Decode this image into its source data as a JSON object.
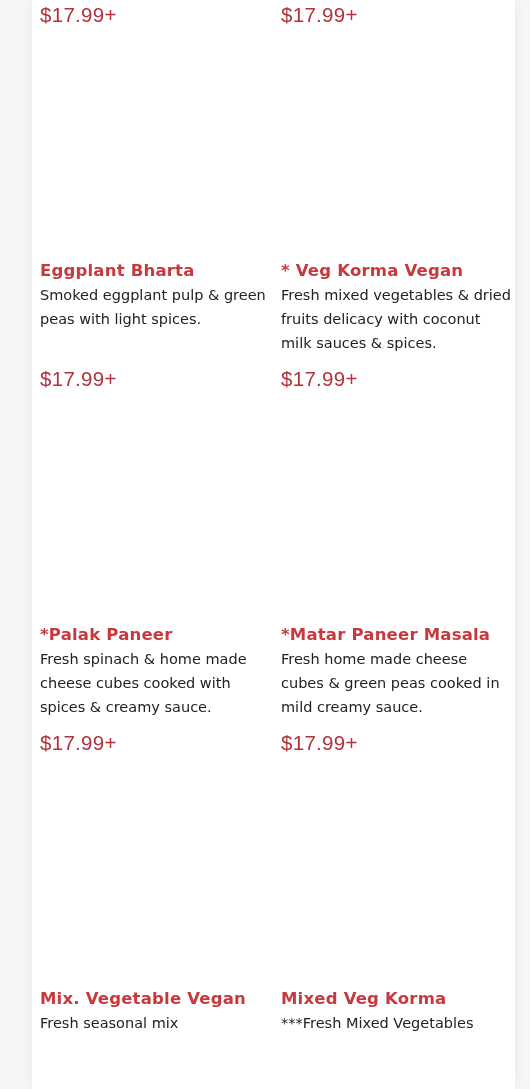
{
  "menu_items": [
    {
      "price": "$17.99+"
    },
    {
      "price": "$17.99+"
    },
    {
      "title": "Eggplant Bharta",
      "description": "Smoked eggplant pulp & green peas with light spices.",
      "price": "$17.99+"
    },
    {
      "title": "* Veg Korma Vegan",
      "description": "Fresh mixed vegetables & dried fruits delicacy with coconut milk sauces & spices.",
      "price": "$17.99+"
    },
    {
      "title": "*Palak Paneer",
      "description": "Fresh spinach & home made cheese cubes cooked with spices & creamy sauce.",
      "price": "$17.99+"
    },
    {
      "title": "*Matar Paneer Masala",
      "description": "Fresh home made cheese cubes & green peas cooked in mild creamy sauce.",
      "price": "$17.99+"
    },
    {
      "title": "Mix. Vegetable Vegan",
      "description": "Fresh seasonal mix"
    },
    {
      "title": "Mixed Veg Korma",
      "description": "***Fresh Mixed Vegetables"
    }
  ]
}
